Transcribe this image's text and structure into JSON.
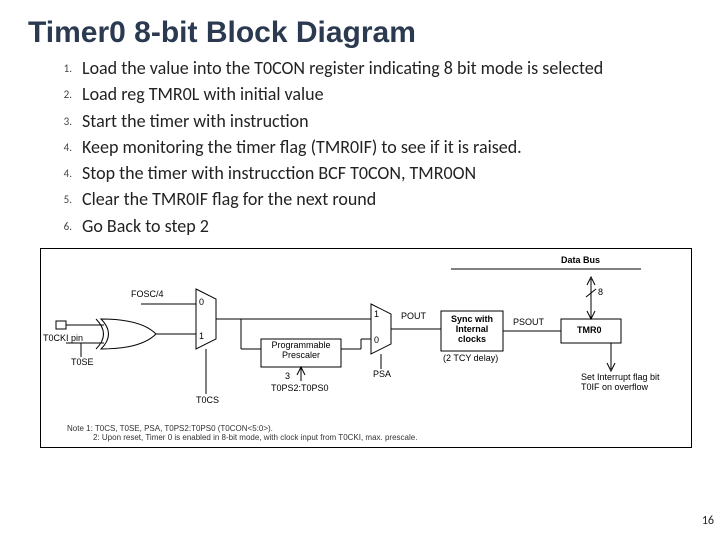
{
  "title": "Timer0 8-bit Block Diagram",
  "steps": [
    {
      "n": "1.",
      "t": "Load the value into the T0CON register indicating 8 bit mode is selected"
    },
    {
      "n": "2.",
      "t": "Load reg TMR0L with initial value"
    },
    {
      "n": "3.",
      "t": "Start the timer with instruction"
    },
    {
      "n": "4.",
      "t": " Keep monitoring the timer flag (TMR0IF) to see if it is raised."
    },
    {
      "n": "4.",
      "t": "Stop the timer with instrucction BCF T0CON, TMR0ON"
    },
    {
      "n": "5.",
      "t": "Clear the TMR0IF flag for the next round"
    },
    {
      "n": "6.",
      "t": "Go Back to step 2"
    }
  ],
  "diagram": {
    "data_bus": "Data Bus",
    "bus_width": "8",
    "fosc": "FOSC/4",
    "t0cki": "T0CKI pin",
    "t0se": "T0SE",
    "t0cs": "T0CS",
    "mux_top_0": "0",
    "mux_top_1": "1",
    "prescaler": "Programmable Prescaler",
    "prescaler_bits": "3",
    "tops": "T0PS2:T0PS0",
    "mux2_1": "1",
    "mux2_0": "0",
    "psa": "PSA",
    "pout": "POUT",
    "sync": "Sync with Internal clocks",
    "delay": "(2 TCY delay)",
    "psout": "PSOUT",
    "tmr0": "TMR0",
    "interrupt": "Set Interrupt flag bit T0IF on overflow"
  },
  "notes": {
    "n1": "Note 1:  T0CS, T0SE, PSA, T0PS2:T0PS0 (T0CON<5:0>).",
    "n2": "2:  Upon reset, Timer 0 is enabled in 8-bit mode, with clock input from T0CKI, max. prescale."
  },
  "pagenum": "16"
}
